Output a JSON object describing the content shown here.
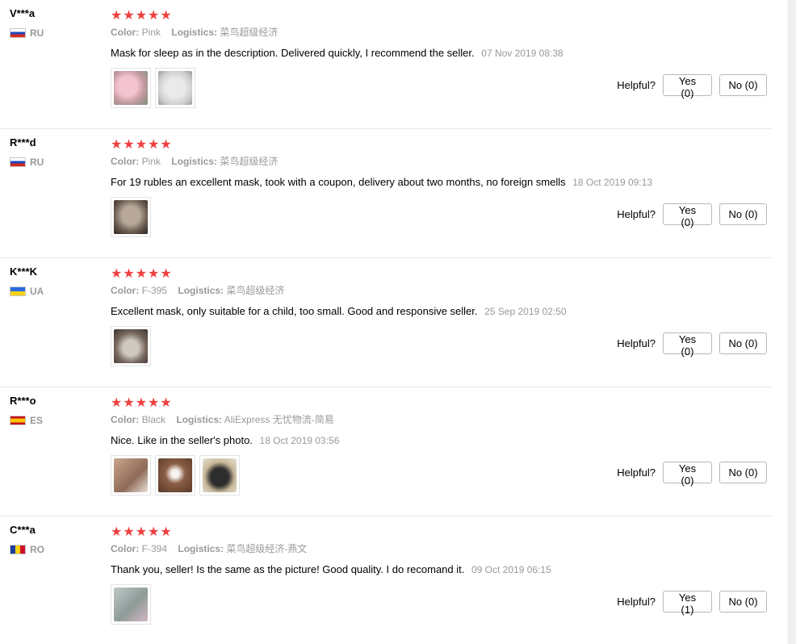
{
  "helpful_label": "Helpful?",
  "meta_labels": {
    "color": "Color:",
    "logistics": "Logistics:"
  },
  "reviews": [
    {
      "user": "V***a",
      "country": "RU",
      "stars": "★★★★★",
      "color": "Pink",
      "logistics": "菜鸟超级经济",
      "text": "Mask for sleep as in the description. Delivered quickly, I recommend the seller.",
      "date": "07 Nov 2019 08:38",
      "yes": "Yes (0)",
      "no": "No (0)"
    },
    {
      "user": "R***d",
      "country": "RU",
      "stars": "★★★★★",
      "color": "Pink",
      "logistics": "菜鸟超级经济",
      "text": "For 19 rubles an excellent mask, took with a coupon, delivery about two months, no foreign smells",
      "date": "18 Oct 2019 09:13",
      "yes": "Yes (0)",
      "no": "No (0)"
    },
    {
      "user": "K***K",
      "country": "UA",
      "stars": "★★★★★",
      "color": "F-395",
      "logistics": "菜鸟超级经济",
      "text": "Excellent mask, only suitable for a child, too small. Good and responsive seller.",
      "date": "25 Sep 2019 02:50",
      "yes": "Yes (0)",
      "no": "No (0)"
    },
    {
      "user": "R***o",
      "country": "ES",
      "stars": "★★★★★",
      "color": "Black",
      "logistics": "AliExpress 无忧物流-简易",
      "text": "Nice. Like in the seller's photo.",
      "date": "18 Oct 2019 03:56",
      "yes": "Yes (0)",
      "no": "No (0)"
    },
    {
      "user": "C***a",
      "country": "RO",
      "stars": "★★★★★",
      "color": "F-394",
      "logistics": "菜鸟超级经济-燕文",
      "text": "Thank you, seller! Is the same as the picture! Good quality. I do recomand it.",
      "date": "09 Oct 2019 06:15",
      "yes": "Yes (1)",
      "no": "No (0)"
    }
  ]
}
